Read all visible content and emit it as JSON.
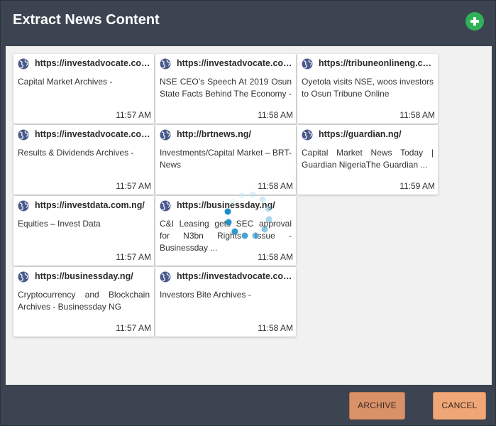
{
  "dialog": {
    "title": "Extract News Content"
  },
  "cards": [
    {
      "url": "https://investadvocate.com.ng/",
      "description": "Capital Market Archives -",
      "time": "11:57 AM"
    },
    {
      "url": "https://investadvocate.com.ng/",
      "description": "NSE CEO’s Speech At 2019 Osun State Facts Behind The Economy -",
      "time": "11:58 AM"
    },
    {
      "url": "https://tribuneonlineng.com/",
      "description": "Oyetola visits NSE, woos investors to Osun Tribune Online",
      "time": "11:58 AM"
    },
    {
      "url": "https://investadvocate.com.ng/",
      "description": "Results & Dividends Archives -",
      "time": "11:57 AM"
    },
    {
      "url": "http://brtnews.ng/",
      "description": "Investments/Capital Market – BRT-News",
      "time": "11:58 AM"
    },
    {
      "url": "https://guardian.ng/",
      "description": "Capital Market News Today | Guardian NigeriaThe Guardian ...",
      "time": "11:59 AM"
    },
    {
      "url": "https://investdata.com.ng/",
      "description": "Equities – Invest Data",
      "time": "11:57 AM"
    },
    {
      "url": "https://businessday.ng/",
      "description": "C&I Leasing gets SEC approval for N3bn Rights Issue - Businessday ...",
      "time": "11:58 AM"
    },
    {
      "url": "https://businessday.ng/",
      "description": "Cryptocurrency and Blockchain Archives - Businessday NG",
      "time": "11:57 AM"
    },
    {
      "url": "https://investadvocate.com.ng/",
      "description": "Investors Bite Archives -",
      "time": "11:58 AM"
    }
  ],
  "buttons": {
    "archive": "ARCHIVE",
    "cancel": "CANCEL"
  },
  "colors": {
    "header_bg": "#3b4450",
    "content_bg": "#f1f1f1",
    "add_button": "#2fb256",
    "archive_button": "#d99168",
    "cancel_button": "#f0a777",
    "spinner": "#1a8fc7"
  },
  "icons": {
    "add": "plus-circle-icon",
    "card": "globe-icon",
    "loading": "spinner-icon"
  }
}
